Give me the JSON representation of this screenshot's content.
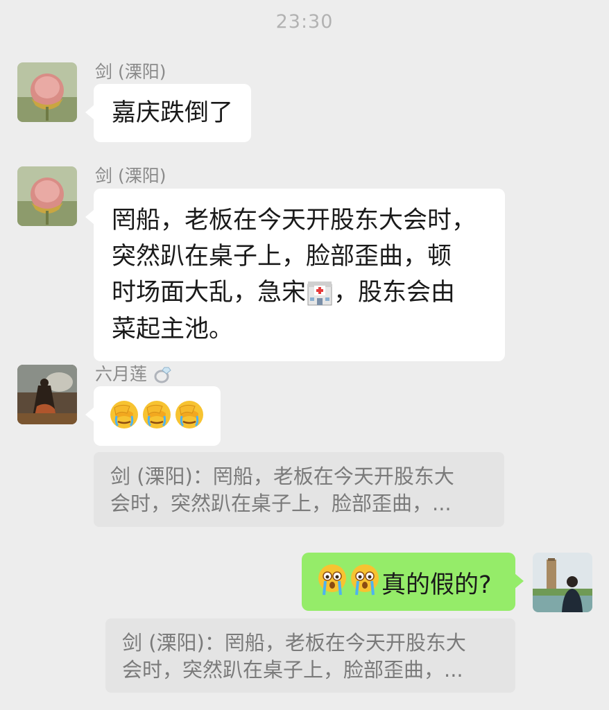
{
  "timestamp": "23:30",
  "messages": [
    {
      "sender": "剑 (溧阳)",
      "lines": [
        "嘉庆跌倒了"
      ]
    },
    {
      "sender": "剑 (溧阳)",
      "lines": [
        "罔船，老板在今天开股东大会时，",
        "突然趴在桌子上，脸部歪曲，顿",
        "时场面大乱，急宋",
        "，股东会由",
        "菜起主池。"
      ]
    },
    {
      "sender": "六月莲",
      "sender_icon": "ring-emoji",
      "emojis": [
        "facepalm-crying-emoji",
        "facepalm-crying-emoji",
        "facepalm-crying-emoji"
      ]
    },
    {
      "sender": "self",
      "emojis": [
        "shocked-crying-emoji",
        "shocked-crying-emoji"
      ],
      "text": "真的假的?"
    }
  ],
  "quotes": [
    {
      "lines": [
        "剑 (溧阳)：罔船，老板在今天开股东大",
        "会时，突然趴在桌子上，脸部歪曲，..."
      ]
    },
    {
      "lines": [
        "剑 (溧阳)：罔船，老板在今天开股东大",
        "会时，突然趴在桌子上，脸部歪曲，..."
      ]
    }
  ],
  "colors": {
    "background": "#ededed",
    "bubble_in": "#ffffff",
    "bubble_out": "#95ec69",
    "quote_bg": "#e4e4e4"
  }
}
